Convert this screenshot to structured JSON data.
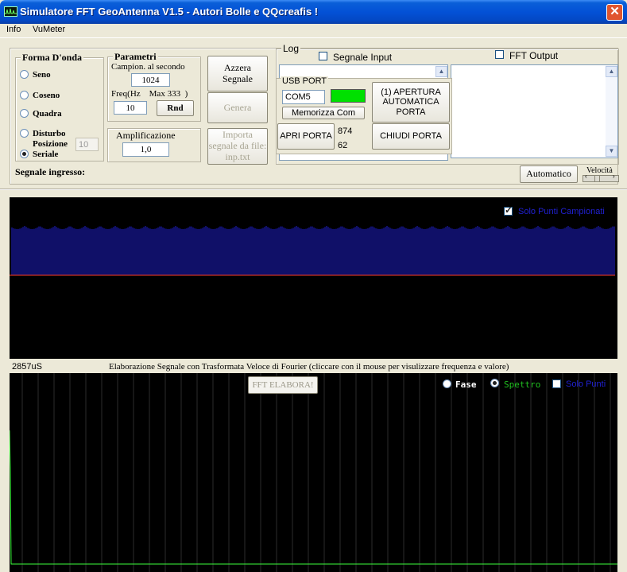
{
  "window": {
    "title": "Simulatore FFT GeoAntenna V1.5 - Autori Bolle e QQcreafis !",
    "close_symbol": "✕"
  },
  "menu": {
    "items": [
      "Info",
      "VuMeter"
    ]
  },
  "waveform": {
    "title": "Forma D'onda",
    "options": [
      {
        "label": "Seno",
        "selected": false
      },
      {
        "label": "Coseno",
        "selected": false
      },
      {
        "label": "Quadra",
        "selected": false
      },
      {
        "label": "Disturbo",
        "selected": false
      },
      {
        "label": "Seriale",
        "selected": true
      }
    ],
    "position_label": "Posizione",
    "position_value": "10"
  },
  "params": {
    "title": "Parametri",
    "samples_label": "Campion. al secondo",
    "samples_value": "1024",
    "freq_label": "Freq(Hz    Max 333  )",
    "freq_value": "10",
    "rnd_label": "Rnd"
  },
  "amplification": {
    "title": "Amplificazione",
    "value": "1,0"
  },
  "buttons": {
    "reset": "Azzera Segnale",
    "generate": "Genera",
    "import": "Importa segnale da file: inp.txt",
    "automatic": "Automatico",
    "speed_label": "Velocità",
    "fft_process": "FFT ELABORA!"
  },
  "log": {
    "title": "Log",
    "signal_input_label": "Segnale Input",
    "signal_input_checked": false,
    "fft_output_label": "FFT Output",
    "fft_output_checked": false
  },
  "usb": {
    "title": "USB PORT",
    "port_value": "COM5",
    "status_color": "#00e000",
    "memorize_label": "Memorizza Com",
    "open_auto_label": "(1) APERTURA AUTOMATICA PORTA",
    "open_label": "APRI PORTA",
    "reading_1": "874",
    "reading_2": "62",
    "close_label": "CHIUDI PORTA"
  },
  "signal": {
    "label": "Segnale ingresso:",
    "sampled_only_label": "Solo Punti Campionati",
    "sampled_only_checked": true,
    "time_label": "2857uS",
    "fft_caption": "Elaborazione Segnale con Trasformata Veloce di Fourier (cliccare con il mouse per visulizzare frequenza e valore)"
  },
  "fft": {
    "phase_label": "Fase",
    "phase_selected": false,
    "spectrum_label": "Spettro",
    "spectrum_selected": true,
    "points_only_label": "Solo Punti",
    "points_only_checked": false
  },
  "colors": {
    "signal_bars": "#1f1fcf",
    "baseline": "#ff3b1f",
    "spectrum_line": "#3cff3c",
    "grid": "#2b2b2b",
    "sampled_label": "#2020d0",
    "spectrum_label_color": "#20c020",
    "points_label_color": "#2020d0"
  }
}
